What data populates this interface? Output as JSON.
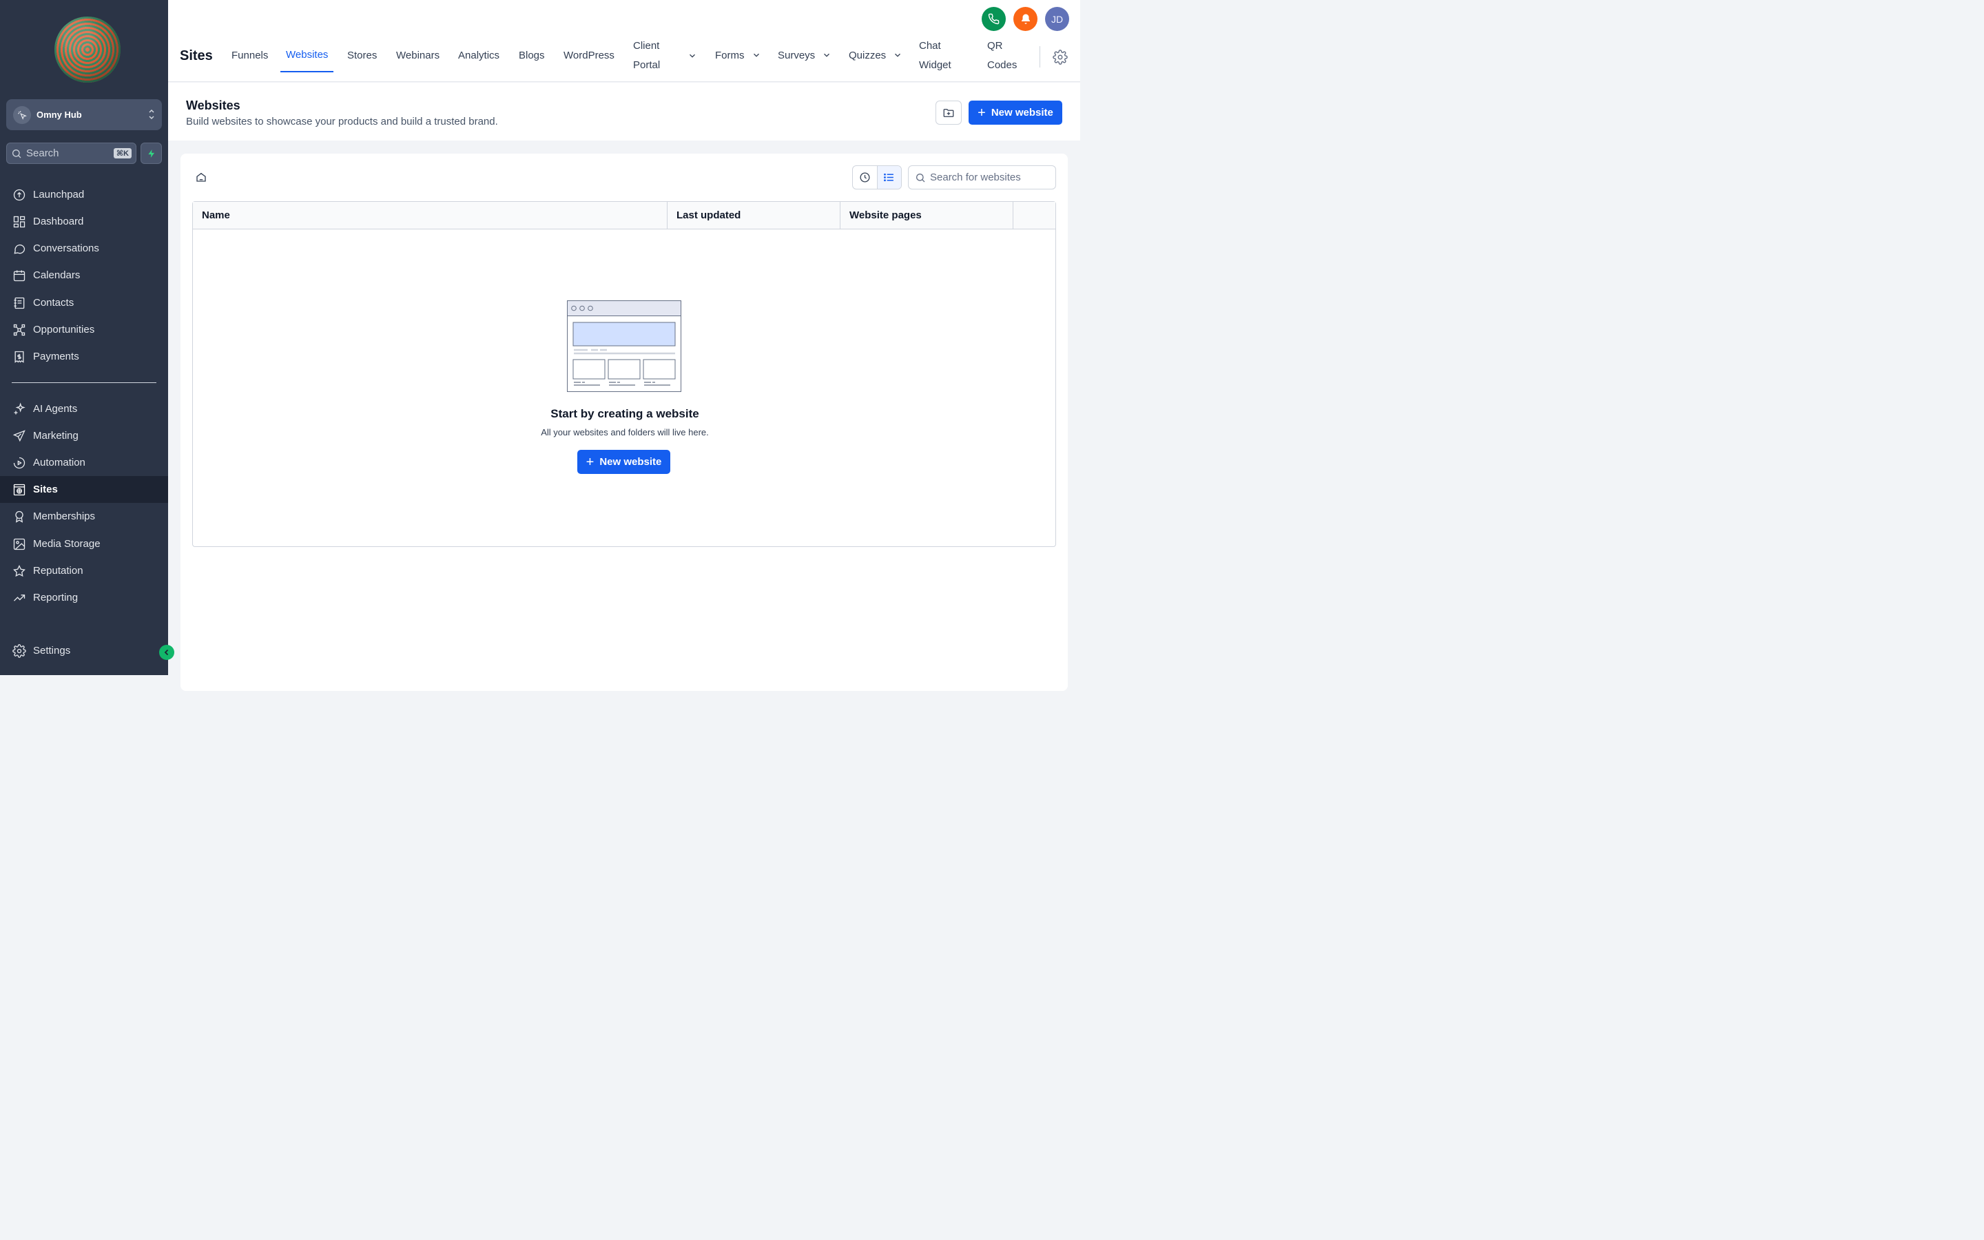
{
  "sidebar": {
    "account": {
      "name": "Omny Hub"
    },
    "search": {
      "label": "Search",
      "shortcut": "⌘K"
    },
    "items_main": [
      {
        "label": "Launchpad",
        "icon": "launchpad-icon"
      },
      {
        "label": "Dashboard",
        "icon": "dashboard-icon"
      },
      {
        "label": "Conversations",
        "icon": "chat-bubble-icon"
      },
      {
        "label": "Calendars",
        "icon": "calendar-icon"
      },
      {
        "label": "Contacts",
        "icon": "contacts-book-icon"
      },
      {
        "label": "Opportunities",
        "icon": "opportunities-icon"
      },
      {
        "label": "Payments",
        "icon": "invoice-icon"
      }
    ],
    "items_secondary": [
      {
        "label": "AI Agents",
        "icon": "sparkles-icon"
      },
      {
        "label": "Marketing",
        "icon": "send-icon"
      },
      {
        "label": "Automation",
        "icon": "play-circle-icon"
      },
      {
        "label": "Sites",
        "icon": "globe-window-icon",
        "active": true
      },
      {
        "label": "Memberships",
        "icon": "badge-icon"
      },
      {
        "label": "Media Storage",
        "icon": "image-icon"
      },
      {
        "label": "Reputation",
        "icon": "star-icon"
      },
      {
        "label": "Reporting",
        "icon": "trend-up-icon"
      }
    ],
    "settings": {
      "label": "Settings"
    }
  },
  "header": {
    "title": "Sites",
    "tabs": [
      {
        "label": "Funnels"
      },
      {
        "label": "Websites",
        "active": true
      },
      {
        "label": "Stores"
      },
      {
        "label": "Webinars"
      },
      {
        "label": "Analytics"
      },
      {
        "label": "Blogs"
      },
      {
        "label": "WordPress"
      },
      {
        "label": "Client",
        "label2": "Portal",
        "dropdown": true
      },
      {
        "label": "Forms",
        "dropdown": true
      },
      {
        "label": "Surveys",
        "dropdown": true
      },
      {
        "label": "Quizzes",
        "dropdown": true
      },
      {
        "label": "Chat",
        "label2": "Widget"
      },
      {
        "label": "QR",
        "label2": "Codes"
      }
    ],
    "avatar_initials": "JD"
  },
  "page": {
    "title": "Websites",
    "subtitle": "Build websites to showcase your products and build a trusted brand.",
    "new_button": "New website"
  },
  "card": {
    "search_placeholder": "Search for websites",
    "columns": [
      "Name",
      "Last updated",
      "Website pages",
      ""
    ],
    "empty_title": "Start by creating a website",
    "empty_subtitle": "All your websites and folders will live here.",
    "empty_button": "New website"
  },
  "colors": {
    "sidebar_bg": "#2b3446",
    "accent": "#155eef",
    "phone": "#079455",
    "bell": "#fb6514",
    "avatar": "#6172b8"
  }
}
